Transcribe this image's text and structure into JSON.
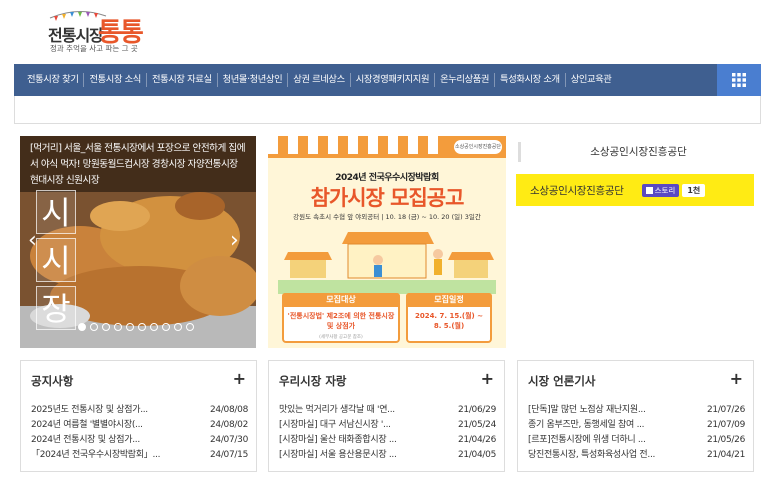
{
  "header": {
    "logo_title": "전통시장",
    "logo_brand": "통통",
    "logo_tagline": "정과 추억을 사고 파는 그 곳"
  },
  "nav": {
    "items": [
      {
        "label": "전통시장 찾기"
      },
      {
        "label": "전통시장 소식"
      },
      {
        "label": "전통시장 자료실"
      },
      {
        "label": "청년몰·청년상인"
      },
      {
        "label": "상권 르네상스"
      },
      {
        "label": "시장경영패키지지원"
      },
      {
        "label": "온누리상품권"
      },
      {
        "label": "특성화시장 소개"
      },
      {
        "label": "상인교육관"
      }
    ],
    "menu_icon": "grid-icon"
  },
  "slider": {
    "caption": "[먹거리] 서울_서울 전통시장에서 포장으로 안전하게 집에서 야식 먹자! 망원동월드컵시장 경창시장 자양전통시장 현대시장 신원시장",
    "vertical_chars": [
      "시",
      "시",
      "장"
    ],
    "prev_icon": "chevron-left-icon",
    "next_icon": "chevron-right-icon",
    "dot_count": 10,
    "active_dot": 0
  },
  "poster": {
    "badge": "소상공인시장진흥공단",
    "subtitle": "2024년 전국우수시장박람회",
    "title": "참가시장 모집공고",
    "date_line": "강원도 속초시 수협 앞 야외공터 | 10. 18 (금) ~ 10. 20 (일) 3일간",
    "box1_title": "모집대상",
    "box1_body": "'전통시장법' 제2조에 의한 전통시장 및 상점가",
    "box1_note": "(세부사항 공고문 참조)",
    "box2_title": "모집일정",
    "box2_body": "2024. 7. 15.(월) ~ 8. 5.(월)"
  },
  "right_panel": {
    "title": "소상공인시장진흥공단",
    "promo_text": "소상공인시장진흥공단",
    "story_label": "스토리",
    "story_count": "1천",
    "accent": "#ffeb14"
  },
  "boards": [
    {
      "title": "공지사항",
      "more": "+",
      "rows": [
        {
          "title": "2025년도 전통시장 및 상점가...",
          "date": "24/08/08"
        },
        {
          "title": "2024년 여름철 '별별야시장(...",
          "date": "24/08/02"
        },
        {
          "title": "2024년 전통시장 및 상점가...",
          "date": "24/07/30"
        },
        {
          "title": "「2024년 전국우수시장박람회」...",
          "date": "24/07/15"
        }
      ]
    },
    {
      "title": "우리시장 자랑",
      "more": "+",
      "rows": [
        {
          "title": "맛있는 먹거리가 생각날 때 '연...",
          "date": "21/06/29"
        },
        {
          "title": "[시장마실] 대구 서남신시장 '...",
          "date": "21/05/24"
        },
        {
          "title": "[시장마실] 울산 태화종합시장 ...",
          "date": "21/04/26"
        },
        {
          "title": "[시장마실] 서울 용산용문시장 ...",
          "date": "21/04/05"
        }
      ]
    },
    {
      "title": "시장 언론기사",
      "more": "+",
      "rows": [
        {
          "title": "[단독]말 많던 노점상 재난지원...",
          "date": "21/07/26"
        },
        {
          "title": "종기 옴부즈만, 동행세일 참여 ...",
          "date": "21/07/09"
        },
        {
          "title": "[르포]전통시장에 위생 더하니 ...",
          "date": "21/05/26"
        },
        {
          "title": "당진전통시장, 특성화육성사업 전...",
          "date": "21/04/21"
        }
      ]
    }
  ],
  "colors": {
    "nav_bg": "#3f5f90",
    "nav_grid_bg": "#4a7ed0",
    "brand_orange": "#e8572a"
  }
}
